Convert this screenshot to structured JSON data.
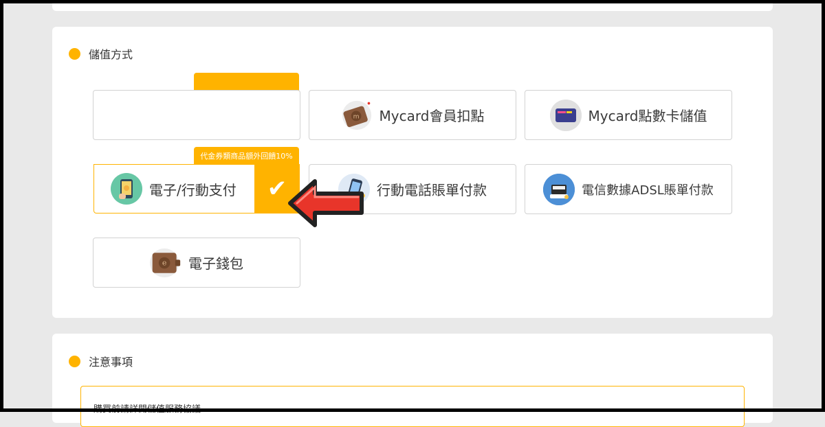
{
  "sections": {
    "methods_title": "儲值方式",
    "notes_title": "注意事項"
  },
  "options": {
    "opt1_label": "",
    "mycard_member": "Mycard會員扣點",
    "mycard_card": "Mycard點數卡儲值",
    "epay": "電子/行動支付",
    "epay_promo": "代金券類商品額外回饋10%",
    "mobile_bill": "行動電話賬單付款",
    "adsl_bill": "電信數據ADSL賬單付款",
    "ewallet": "電子錢包"
  },
  "notes": {
    "line1": "購買前請詳閱儲值服務協議"
  },
  "icons": {
    "mycard_member": "wallet-m-icon",
    "mycard_card": "mycard-card-icon",
    "epay": "phone-pay-icon",
    "mobile_bill": "mobile-phone-icon",
    "adsl_bill": "router-icon",
    "ewallet": "wallet-e-icon",
    "check": "check-icon",
    "arrow": "red-arrow-icon"
  },
  "colors": {
    "accent": "#ffb300",
    "arrow": "#e8352a"
  }
}
